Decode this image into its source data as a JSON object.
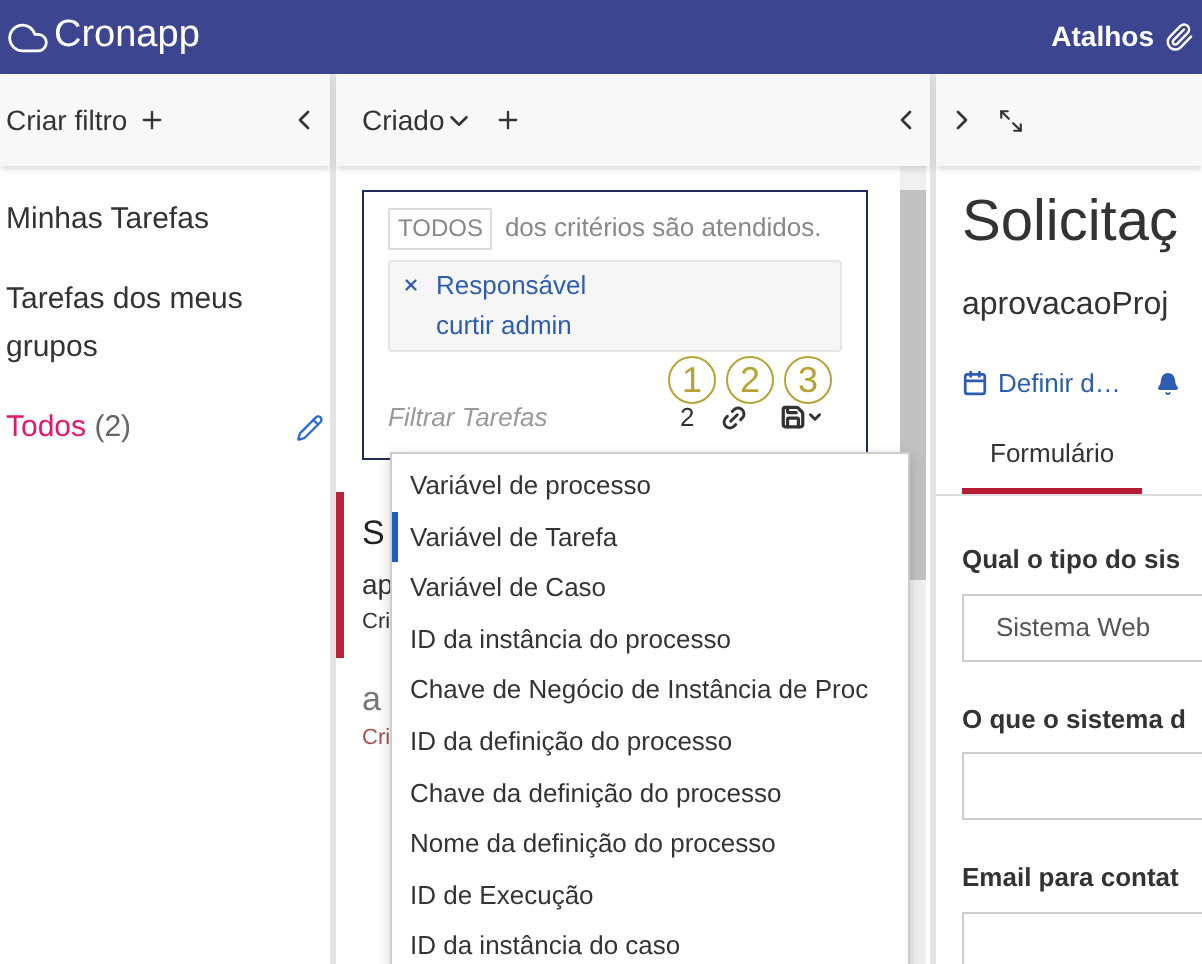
{
  "header": {
    "brand": "Cronapp",
    "shortcuts": "Atalhos"
  },
  "filters_panel": {
    "create": "Criar filtro",
    "items": [
      {
        "label": "Minhas Tarefas",
        "selected": false
      },
      {
        "label": "Tarefas dos meus grupos",
        "selected": false
      },
      {
        "label": "Todos",
        "count": "(2)",
        "selected": true,
        "editable": true
      }
    ]
  },
  "tasks_panel": {
    "sort": "Criado",
    "filter": {
      "match": "TODOS",
      "match_text": "dos critérios são atendidos.",
      "criterion": "Responsável curtir admin",
      "placeholder": "Filtrar Tarefas",
      "count": "2"
    },
    "annotations": [
      "1",
      "2",
      "3"
    ],
    "tasks": [
      {
        "title": "S",
        "subtitle": "ap",
        "created": "Cri",
        "selected": true
      },
      {
        "title": "a",
        "created": "Cri",
        "selected": false
      }
    ],
    "menu": [
      {
        "label": "Variável de processo",
        "selected": false
      },
      {
        "label": "Variável de Tarefa",
        "selected": true
      },
      {
        "label": "Variável de Caso",
        "selected": false
      },
      {
        "label": "ID da instância do processo",
        "selected": false
      },
      {
        "label": "Chave de Negócio de Instância de Proc",
        "selected": false
      },
      {
        "label": "ID da definição do processo",
        "selected": false
      },
      {
        "label": "Chave da definição do processo",
        "selected": false
      },
      {
        "label": "Nome da definição do processo",
        "selected": false
      },
      {
        "label": "ID de Execução",
        "selected": false
      },
      {
        "label": "ID da instância do caso",
        "selected": false
      }
    ]
  },
  "detail_panel": {
    "title": "Solicitaç",
    "subtitle": "aprovacaoProj",
    "due": "Definir d…",
    "tabs": [
      {
        "label": "Formulário",
        "selected": true
      }
    ],
    "fields": [
      {
        "label": "Qual o tipo do sis",
        "value": "Sistema Web"
      },
      {
        "label": "O que o sistema d"
      },
      {
        "label": "Email para contat"
      }
    ]
  }
}
